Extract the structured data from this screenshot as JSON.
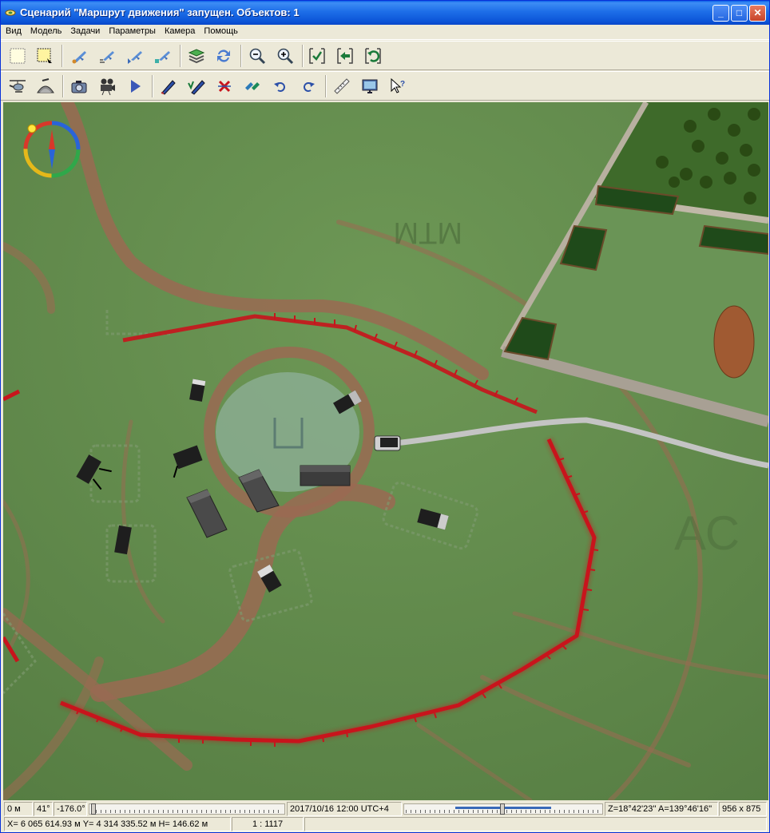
{
  "window": {
    "title": "Сценарий \"Маршрут движения\" запущен. Объектов: 1",
    "minimize_glyph": "_",
    "maximize_glyph": "□",
    "close_glyph": "✕"
  },
  "menu": [
    "Вид",
    "Модель",
    "Задачи",
    "Параметры",
    "Камера",
    "Помощь"
  ],
  "toolbar1": [
    "select-rect-icon",
    "select-area-icon",
    "aircraft-add-icon",
    "aircraft-group-icon",
    "aircraft-route-icon",
    "aircraft-formation-icon",
    "layers-icon",
    "refresh-icon",
    "zoom-out-icon",
    "zoom-in-icon",
    "check-frame-icon",
    "back-arrow-icon",
    "undo-frame-icon"
  ],
  "toolbar2": [
    "helicopter-icon",
    "base-icon",
    "camera-icon",
    "video-camera-icon",
    "play-icon",
    "pen-icon",
    "pen-edit-icon",
    "delete-icon",
    "swap-icon",
    "undo-icon",
    "redo-icon",
    "ruler-icon",
    "monitor-icon",
    "help-pointer-icon"
  ],
  "map": {
    "label": "МТМ",
    "colors": {
      "terrain": "#5f8a4a",
      "road": "#9a6a52",
      "border": "#c8141c",
      "route": "#c4c4c4"
    }
  },
  "status": {
    "distance": "0 м",
    "angle": "41°",
    "heading": "-176.0°",
    "datetime": "2017/10/16  12:00  UTC+4",
    "camera": "Z=18°42'23''  A=139°46'16''",
    "resolution": "956 x 875",
    "coords": "X= 6 065 614.93 м  Y= 4 314 335.52 м  H= 146.62 м",
    "scale": "1 : 1117"
  }
}
